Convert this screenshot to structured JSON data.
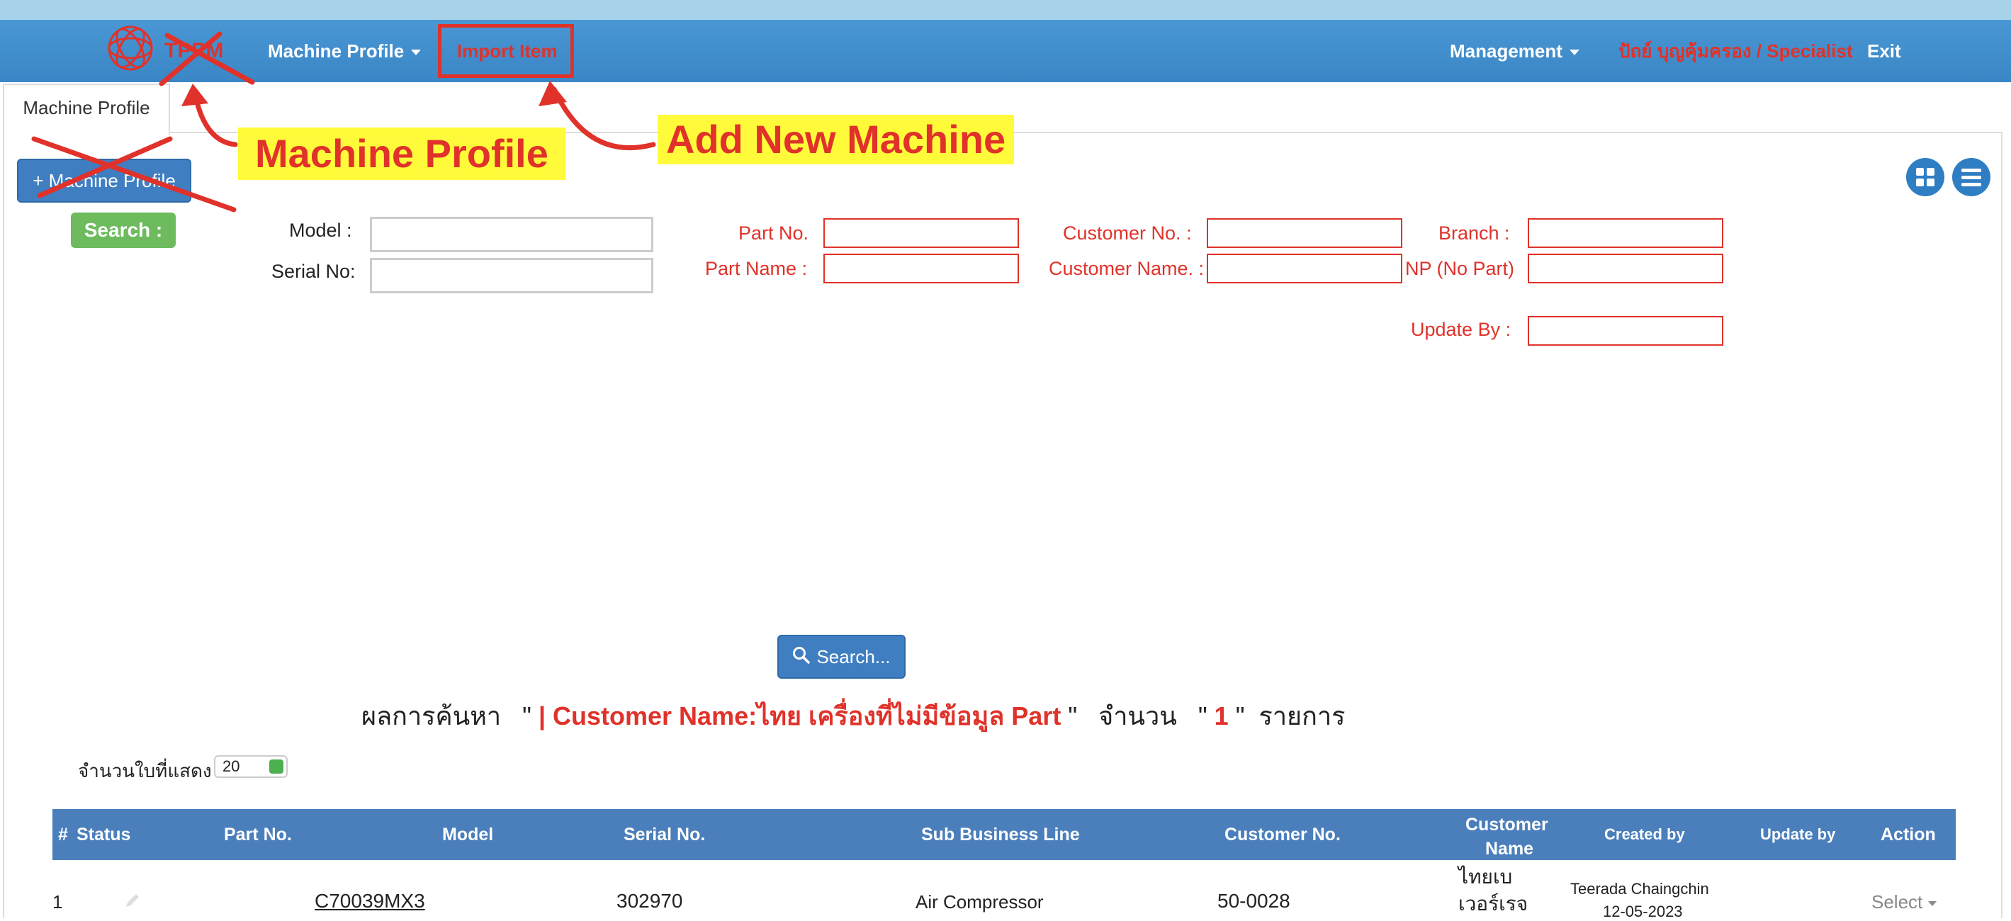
{
  "nav": {
    "logo_text": "TPPM",
    "machine_profile": "Machine Profile",
    "import_item": "Import Item",
    "management": "Management",
    "user": "ปัถย์ บุญคุ้มครอง / Specialist",
    "exit": "Exit"
  },
  "tab": {
    "label": "Machine Profile"
  },
  "buttons": {
    "add_machine_profile": "+ Machine Profile",
    "search_tag": "Search :",
    "search": "Search..."
  },
  "form": {
    "model_label": "Model :",
    "serial_label": "Serial No:",
    "part_no_label": "Part No.",
    "part_name_label": "Part Name :",
    "customer_no_label": "Customer No. :",
    "customer_name_label": "Customer Name. :",
    "branch_label": "Branch :",
    "np_label": "NP (No Part)",
    "update_by_label": "Update By :"
  },
  "result": {
    "prefix": "ผลการค้นหา",
    "quote_open": "\"",
    "query": "| Customer Name:ไทย เครื่องที่ไม่มีข้อมูล Part",
    "quote_close": "\"",
    "count_label": "จำนวน",
    "count": "1",
    "suffix": "รายการ"
  },
  "per_page": {
    "label": "จำนวนใบที่แสดง",
    "value": "20"
  },
  "table": {
    "headers": {
      "num": "#",
      "status": "Status",
      "part_no": "Part No.",
      "model": "Model",
      "serial_no": "Serial No.",
      "sub_business_line": "Sub Business Line",
      "customer_no": "Customer No.",
      "customer_name_1": "Customer",
      "customer_name_2": "Name",
      "created_by": "Created by",
      "update_by": "Update by",
      "action": "Action"
    },
    "rows": [
      {
        "num": "1",
        "part_no": "",
        "model": "C70039MX3",
        "serial_no": "302970",
        "sub_business_line": "Air Compressor",
        "customer_no": "50-0028",
        "customer_name_1": "ไทยเบ",
        "customer_name_2": "เวอร์เรจ",
        "created_by": "Teerada Chaingchin",
        "created_date": "12-05-2023",
        "update_by": "",
        "action": "Select"
      }
    ]
  },
  "annotations": {
    "machine_profile": "Machine Profile",
    "add_new_machine": "Add New Machine"
  },
  "colors": {
    "navbar": "#3a86c6",
    "accent_red": "#e0322a",
    "annotation_bg": "#fffb3a",
    "table_header": "#4a7fbc",
    "search_tag": "#6dbb5d"
  }
}
